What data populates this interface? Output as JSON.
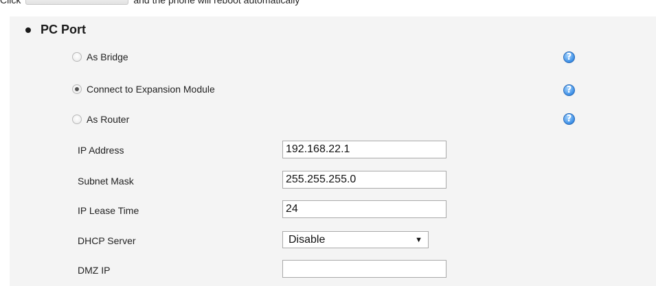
{
  "top_note": {
    "prefix": "Click",
    "suffix": "and the phone will reboot automatically"
  },
  "section": {
    "title": "PC Port",
    "modes": [
      {
        "label": "As Bridge",
        "checked": false,
        "help_icon": "question-mark-icon"
      },
      {
        "label": "Connect to Expansion Module",
        "checked": true,
        "help_icon": "question-mark-icon"
      },
      {
        "label": "As Router",
        "checked": false,
        "help_icon": "question-mark-icon"
      }
    ],
    "help_glyph": "?"
  },
  "router": {
    "ip_address": {
      "label": "IP Address",
      "value": "192.168.22.1"
    },
    "subnet_mask": {
      "label": "Subnet Mask",
      "value": "255.255.255.0"
    },
    "ip_lease_time": {
      "label": "IP Lease Time",
      "value": "24"
    },
    "dhcp_server": {
      "label": "DHCP Server",
      "value": "Disable",
      "arrow": "▼"
    },
    "dmz_ip": {
      "label": "DMZ IP",
      "value": ""
    }
  },
  "colors": {
    "panel_background": "#f4f4f4",
    "help_icon_blue": "#3b8ee6"
  }
}
